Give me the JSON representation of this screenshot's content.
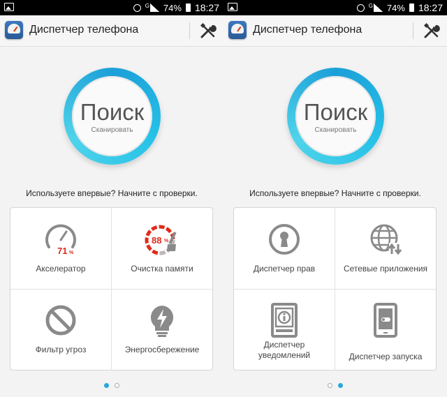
{
  "status": {
    "network": "G",
    "battery": "74%",
    "time": "18:27"
  },
  "app": {
    "title": "Диспетчер телефона"
  },
  "scan": {
    "title": "Поиск",
    "subtitle": "Сканировать"
  },
  "hint": "Используете впервые? Начните с проверки.",
  "left": {
    "tiles": [
      {
        "label": "Акселератор",
        "value": "71",
        "unit": "%"
      },
      {
        "label": "Очистка памяти",
        "value": "88",
        "unit": "%"
      },
      {
        "label": "Фильтр угроз"
      },
      {
        "label": "Энергосбережение"
      }
    ]
  },
  "right": {
    "tiles": [
      {
        "label": "Диспетчер прав"
      },
      {
        "label": "Сетевые приложения"
      },
      {
        "label": "Диспетчер уведомлений"
      },
      {
        "label": "Диспетчер запуска"
      }
    ]
  },
  "pager": {
    "pages": 2,
    "left_active": 1,
    "right_active": 2
  },
  "colors": {
    "accent": "#27a8d8",
    "highlight_red": "#e02a1a",
    "icon_gray": "#8a8a8a"
  }
}
